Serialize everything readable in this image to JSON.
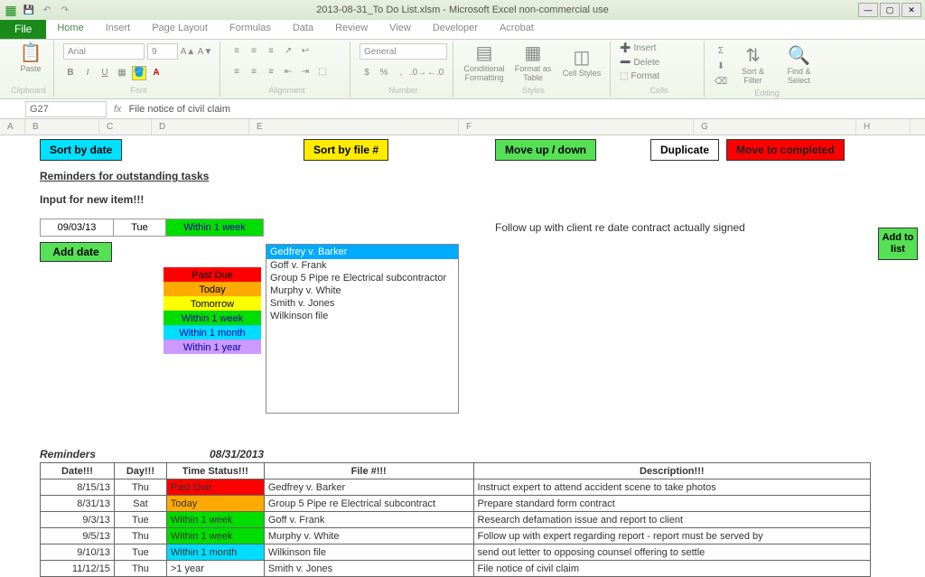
{
  "window": {
    "title": "2013-08-31_To Do List.xlsm - Microsoft Excel non-commercial use"
  },
  "ribbon": {
    "file": "File",
    "tabs": [
      "Home",
      "Insert",
      "Page Layout",
      "Formulas",
      "Data",
      "Review",
      "View",
      "Developer",
      "Acrobat"
    ],
    "font_name": "Arial",
    "font_size": "9",
    "number_format": "General",
    "groups": {
      "clipboard": "Clipboard",
      "font": "Font",
      "alignment": "Alignment",
      "number": "Number",
      "styles": "Styles",
      "cells": "Cells",
      "editing": "Editing"
    },
    "styles": {
      "cond_fmt": "Conditional Formatting",
      "as_table": "Format as Table",
      "cell_styles": "Cell Styles"
    },
    "cells": {
      "insert": "Insert",
      "delete": "Delete",
      "format": "Format"
    },
    "editing": {
      "sort": "Sort & Filter",
      "find": "Find & Select"
    }
  },
  "formula_bar": {
    "name_box": "G27",
    "formula": "File notice of civil claim"
  },
  "columns": [
    "A",
    "B",
    "C",
    "D",
    "E",
    "F",
    "G",
    "H"
  ],
  "buttons": {
    "sort_date": "Sort by date",
    "sort_file": "Sort by file #",
    "move": "Move up / down",
    "duplicate": "Duplicate",
    "move_completed": "Move to completed",
    "add_date": "Add date",
    "add_list": "Add to list"
  },
  "labels": {
    "section_title": "Reminders for outstanding tasks",
    "input_label": "Input for new item!!!",
    "reminders": "Reminders",
    "rem_date": "08/31/2013"
  },
  "input_row": {
    "date": "09/03/13",
    "day": "Tue",
    "status": "Within 1 week",
    "followup": "Follow up with client re date contract actually signed"
  },
  "dropdown": {
    "selected": "Gedfrey v. Barker",
    "items": [
      "Goff v. Frank",
      "Group 5 Pipe re Electrical subcontractor",
      "Murphy v. White",
      "Smith v. Jones",
      "Wilkinson file"
    ]
  },
  "status_stack": [
    "Past Due",
    "Today",
    "Tomorrow",
    "Within 1 week",
    "Within 1 month",
    "Within 1 year"
  ],
  "table": {
    "headers": {
      "date": "Date!!!",
      "day": "Day!!!",
      "status": "Time Status!!!",
      "file": "File #!!!",
      "desc": "Description!!!"
    },
    "rows": [
      {
        "date": "8/15/13",
        "day": "Thu",
        "status": "Past Due",
        "status_cls": "st-red",
        "file": "Gedfrey v. Barker",
        "desc": "Instruct expert to attend accident scene to take photos"
      },
      {
        "date": "8/31/13",
        "day": "Sat",
        "status": "Today",
        "status_cls": "st-org",
        "file": "Group 5 Pipe re Electrical subcontract",
        "desc": "Prepare standard form contract"
      },
      {
        "date": "9/3/13",
        "day": "Tue",
        "status": "Within 1 week",
        "status_cls": "st-grn",
        "file": "Goff v. Frank",
        "desc": "Research defamation issue and report to client"
      },
      {
        "date": "9/5/13",
        "day": "Thu",
        "status": "Within 1 week",
        "status_cls": "st-grn",
        "file": "Murphy v. White",
        "desc": "Follow up with expert regarding report - report must be served by"
      },
      {
        "date": "9/10/13",
        "day": "Tue",
        "status": "Within 1 month",
        "status_cls": "st-blu",
        "file": "Wilkinson file",
        "desc": "send out letter to opposing counsel offering to settle"
      },
      {
        "date": "11/12/15",
        "day": "Thu",
        "status": ">1 year",
        "status_cls": "st-plain",
        "file": "Smith v. Jones",
        "desc": "File notice of civil claim"
      }
    ]
  }
}
